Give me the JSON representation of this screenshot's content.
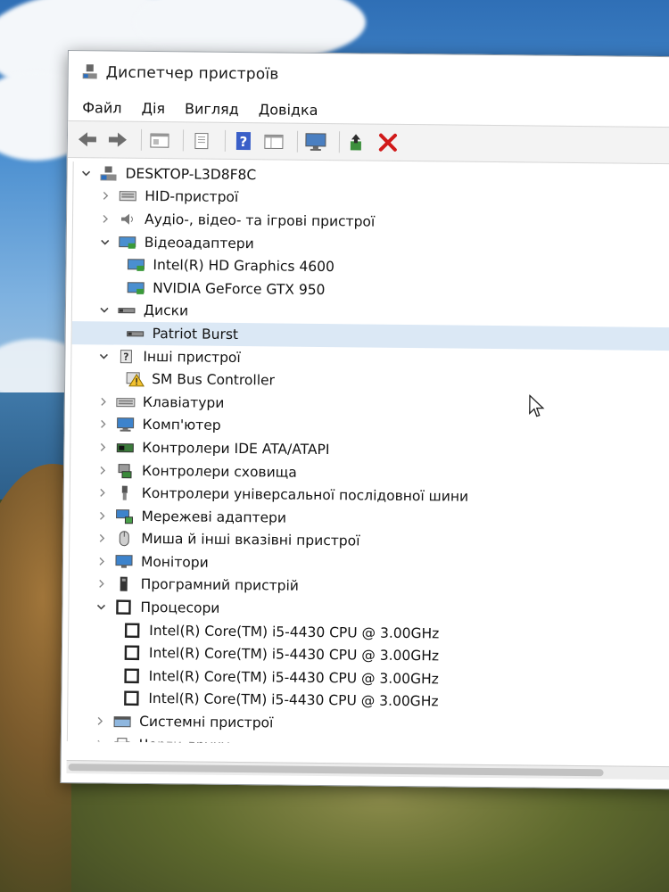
{
  "window": {
    "title": "Диспетчер пристроїв",
    "menu": [
      "Файл",
      "Дія",
      "Вигляд",
      "Довідка"
    ],
    "toolbar_icons": [
      "back-icon",
      "forward-icon",
      "properties-icon",
      "show-hide-icon",
      "help-icon",
      "scan-changes-icon",
      "monitor-icon",
      "update-driver-icon",
      "uninstall-icon"
    ]
  },
  "tree": {
    "root": "DESKTOP-L3D8F8C",
    "rows": [
      {
        "level": 1,
        "expanded": false,
        "icon": "hid-icon",
        "label": "HID-пристрої"
      },
      {
        "level": 1,
        "expanded": false,
        "icon": "audio-icon",
        "label": "Аудіо-, відео- та ігрові пристрої"
      },
      {
        "level": 1,
        "expanded": true,
        "icon": "display-adapter-icon",
        "label": "Відеоадаптери"
      },
      {
        "level": 2,
        "icon": "display-adapter-icon",
        "label": "Intel(R) HD Graphics 4600"
      },
      {
        "level": 2,
        "icon": "display-adapter-icon",
        "label": "NVIDIA GeForce GTX 950"
      },
      {
        "level": 1,
        "expanded": true,
        "icon": "disk-icon",
        "label": "Диски"
      },
      {
        "level": 2,
        "icon": "disk-icon",
        "label": "Patriot Burst",
        "selected": true
      },
      {
        "level": 1,
        "expanded": true,
        "icon": "other-devices-icon",
        "label": "Інші пристрої"
      },
      {
        "level": 2,
        "icon": "warning-device-icon",
        "label": "SM Bus Controller"
      },
      {
        "level": 1,
        "expanded": false,
        "icon": "keyboard-icon",
        "label": "Клавіатури"
      },
      {
        "level": 1,
        "expanded": false,
        "icon": "computer-icon",
        "label": "Комп'ютер"
      },
      {
        "level": 1,
        "expanded": false,
        "icon": "ide-icon",
        "label": "Контролери IDE ATA/ATAPI"
      },
      {
        "level": 1,
        "expanded": false,
        "icon": "storage-icon",
        "label": "Контролери сховища"
      },
      {
        "level": 1,
        "expanded": false,
        "icon": "usb-icon",
        "label": "Контролери універсальної послідовної шини"
      },
      {
        "level": 1,
        "expanded": false,
        "icon": "network-icon",
        "label": "Мережеві адаптери"
      },
      {
        "level": 1,
        "expanded": false,
        "icon": "mouse-icon",
        "label": "Миша й інші вказівні пристрої"
      },
      {
        "level": 1,
        "expanded": false,
        "icon": "monitor-icon",
        "label": "Монітори"
      },
      {
        "level": 1,
        "expanded": false,
        "icon": "firmware-icon",
        "label": "Програмний пристрій"
      },
      {
        "level": 1,
        "expanded": true,
        "icon": "cpu-icon",
        "label": "Процесори"
      },
      {
        "level": 2,
        "icon": "cpu-icon",
        "label": "Intel(R) Core(TM) i5-4430 CPU @ 3.00GHz"
      },
      {
        "level": 2,
        "icon": "cpu-icon",
        "label": "Intel(R) Core(TM) i5-4430 CPU @ 3.00GHz"
      },
      {
        "level": 2,
        "icon": "cpu-icon",
        "label": "Intel(R) Core(TM) i5-4430 CPU @ 3.00GHz"
      },
      {
        "level": 2,
        "icon": "cpu-icon",
        "label": "Intel(R) Core(TM) i5-4430 CPU @ 3.00GHz"
      },
      {
        "level": 1,
        "expanded": false,
        "icon": "system-devices-icon",
        "label": "Системні пристрої"
      },
      {
        "level": 1,
        "expanded": false,
        "icon": "print-queue-icon",
        "label": "Черги друку"
      }
    ]
  }
}
